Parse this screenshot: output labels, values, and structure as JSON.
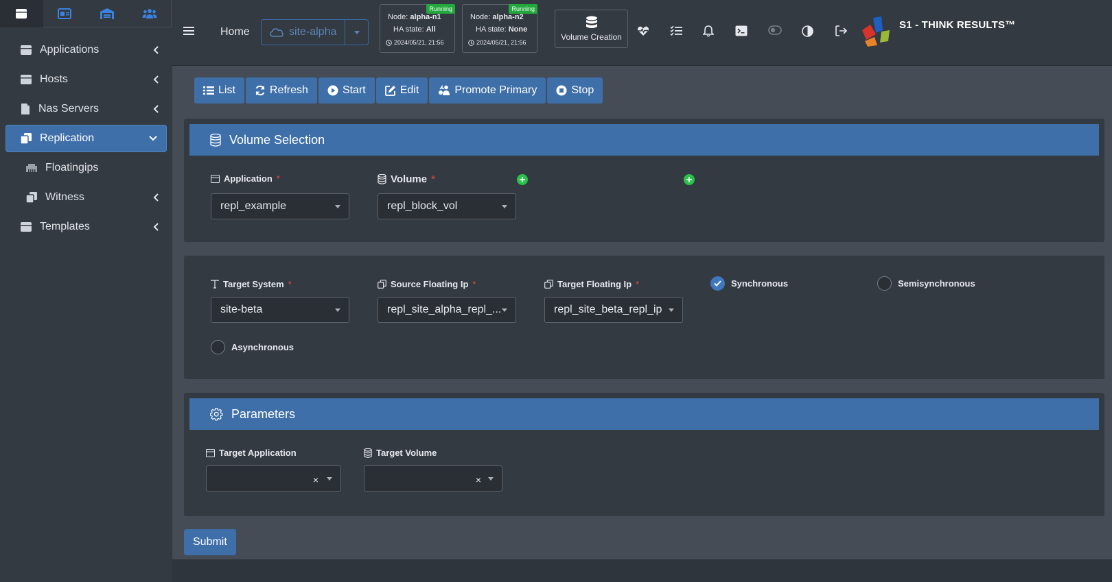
{
  "colors": {
    "accent": "#3e6fa8",
    "running_badge": "#23a83e",
    "required": "#e74c3c",
    "add": "#2ac24a"
  },
  "sidebar": {
    "top_tabs": [
      {
        "icon": "window-icon"
      },
      {
        "icon": "card-icon"
      },
      {
        "icon": "warehouse-icon"
      },
      {
        "icon": "users-icon"
      }
    ],
    "items": [
      {
        "label": "Applications",
        "icon": "window-icon"
      },
      {
        "label": "Hosts",
        "icon": "window-icon"
      },
      {
        "label": "Nas Servers",
        "icon": "file-icon"
      },
      {
        "label": "Replication",
        "icon": "copy-icon",
        "active": true
      },
      {
        "label": "Floatingips",
        "icon": "ethernet-icon"
      },
      {
        "label": "Witness",
        "icon": "copy-icon"
      },
      {
        "label": "Templates",
        "icon": "window-icon"
      }
    ]
  },
  "topbar": {
    "home": "Home",
    "site": "site-alpha",
    "nodes": [
      {
        "badge": "Running",
        "node_label": "Node:",
        "node": "alpha-n1",
        "ha_label": "HA state:",
        "ha": "All",
        "time": "2024/05/21, 21:56"
      },
      {
        "badge": "Running",
        "node_label": "Node:",
        "node": "alpha-n2",
        "ha_label": "HA state:",
        "ha": "None",
        "time": "2024/05/21, 21:56"
      }
    ],
    "volume_creation": "Volume Creation",
    "brand": "S1 - THINK RESULTS™"
  },
  "toolbar": {
    "list": "List",
    "refresh": "Refresh",
    "start": "Start",
    "edit": "Edit",
    "promote": "Promote Primary",
    "stop": "Stop"
  },
  "volume_selection": {
    "title": "Volume Selection",
    "application_label": "Application",
    "application_value": "repl_example",
    "volume_label": "Volume",
    "volume_value": "repl_block_vol",
    "required_mark": "*"
  },
  "replication": {
    "target_system_label": "Target System",
    "target_system_value": "site-beta",
    "source_ip_label": "Source Floating Ip",
    "source_ip_value": "repl_site_alpha_repl_...",
    "target_ip_label": "Target Floating Ip",
    "target_ip_value": "repl_site_beta_repl_ip",
    "modes": [
      "Synchronous",
      "Semisynchronous",
      "Asynchronous"
    ],
    "selected_mode": "Synchronous"
  },
  "parameters": {
    "title": "Parameters",
    "target_application_label": "Target Application",
    "target_volume_label": "Target Volume",
    "clear_glyph": "×"
  },
  "submit": "Submit"
}
